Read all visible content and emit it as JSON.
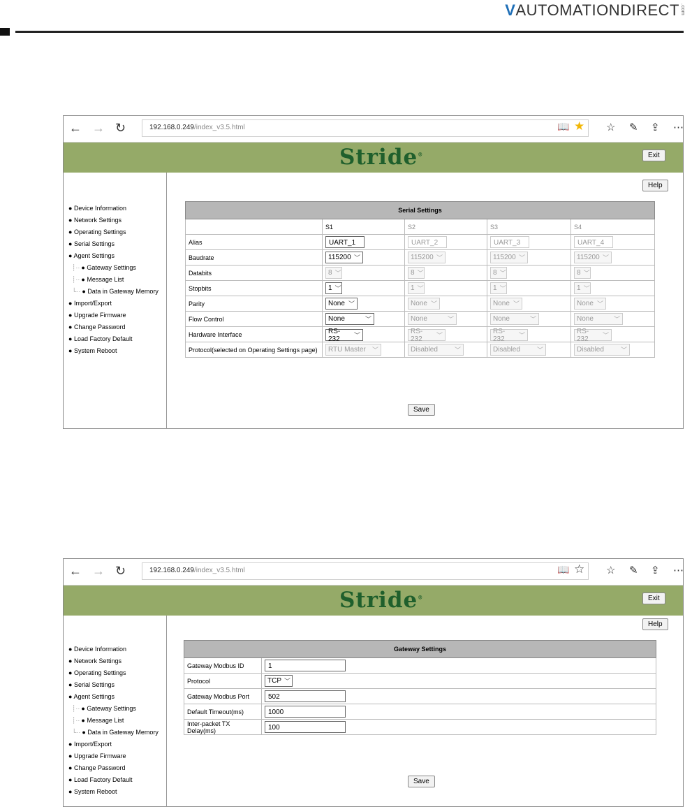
{
  "header": {
    "logo": "AUTOMATIONDIRECT",
    "logo_mark": "V",
    "logo_com": ".com"
  },
  "browser": {
    "address_host": "192.168.0.249",
    "address_path": "/index_v3.5.html",
    "icons": [
      "back-arrow-icon",
      "forward-arrow-icon",
      "refresh-icon",
      "reading-view-icon",
      "favorite-star-icon",
      "favorites-hub-icon",
      "web-note-icon",
      "share-icon",
      "more-icon"
    ],
    "star_color_top": "#f2b705"
  },
  "app": {
    "logo": "Stride",
    "logo_mark": "®",
    "exit_label": "Exit",
    "help_label": "Help",
    "save_label": "Save",
    "banner_color": "#95aa68"
  },
  "sidebar": {
    "items": [
      "Device Information",
      "Network Settings",
      "Operating Settings",
      "Serial Settings",
      "Agent Settings",
      "Gateway Settings",
      "Message List",
      "Data in Gateway Memory",
      "Import/Export",
      "Upgrade Firmware",
      "Change Password",
      "Load Factory Default",
      "System Reboot"
    ]
  },
  "serial": {
    "title": "Serial Settings",
    "columns": [
      "S1",
      "S2",
      "S3",
      "S4"
    ],
    "rows": [
      {
        "label": "Alias",
        "values": [
          "UART_1",
          "UART_2",
          "UART_3",
          "UART_4"
        ]
      },
      {
        "label": "Baudrate",
        "values": [
          "115200",
          "115200",
          "115200",
          "115200"
        ]
      },
      {
        "label": "Databits",
        "values": [
          "8",
          "8",
          "8",
          "8"
        ]
      },
      {
        "label": "Stopbits",
        "values": [
          "1",
          "1",
          "1",
          "1"
        ]
      },
      {
        "label": "Parity",
        "values": [
          "None",
          "None",
          "None",
          "None"
        ]
      },
      {
        "label": "Flow Control",
        "values": [
          "None",
          "None",
          "None",
          "None"
        ]
      },
      {
        "label": "Hardware Interface",
        "values": [
          "RS-232",
          "RS-232",
          "RS-232",
          "RS-232"
        ]
      },
      {
        "label": "Protocol(selected on Operating Settings page)",
        "values": [
          "RTU Master",
          "Disabled",
          "Disabled",
          "Disabled"
        ]
      }
    ]
  },
  "gateway": {
    "title": "Gateway Settings",
    "rows": [
      {
        "label": "Gateway Modbus ID",
        "value": "1"
      },
      {
        "label": "Protocol",
        "value": "TCP"
      },
      {
        "label": "Gateway Modbus Port",
        "value": "502"
      },
      {
        "label": "Default Timeout(ms)",
        "value": "1000"
      },
      {
        "label": "Inter-packet TX Delay(ms)",
        "value": "100"
      }
    ]
  }
}
